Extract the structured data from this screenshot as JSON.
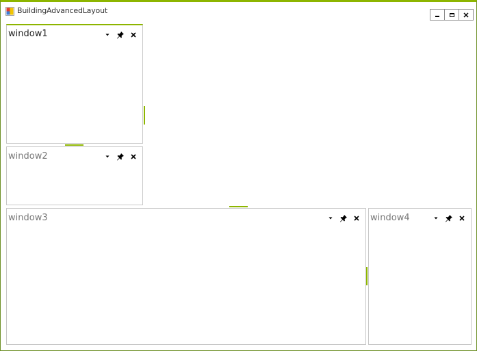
{
  "window": {
    "title": "BuildingAdvancedLayout",
    "accent_color": "#8db500",
    "icon": "app-icon",
    "caption_buttons": [
      {
        "name": "minimize-button",
        "icon": "minimize-icon"
      },
      {
        "name": "maximize-button",
        "icon": "maximize-icon"
      },
      {
        "name": "close-button",
        "icon": "close-icon"
      }
    ]
  },
  "panes": [
    {
      "title": "window1",
      "active": true
    },
    {
      "title": "window2",
      "active": false
    },
    {
      "title": "window3",
      "active": false
    },
    {
      "title": "window4",
      "active": false
    }
  ],
  "pane_tools": {
    "menu_icon": "dropdown-arrow-icon",
    "pin_icon": "pin-icon",
    "close_icon": "close-icon"
  }
}
